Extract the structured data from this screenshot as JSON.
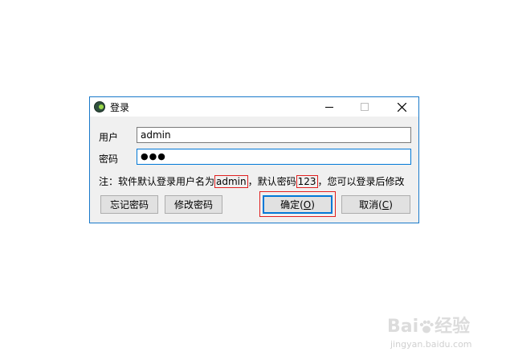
{
  "window": {
    "title": "登录",
    "username_label": "用户",
    "password_label": "密码",
    "username_value": "admin",
    "password_value": "●●●",
    "note_prefix": "注：软件默认登录用户名为",
    "note_user": "admin",
    "note_middle": "，默认密码",
    "note_pass": "123",
    "note_suffix": "，您可以登录后修改",
    "buttons": {
      "forgot": "忘记密码",
      "change": "修改密码",
      "ok_text": "确定(",
      "ok_key": "O",
      "ok_end": ")",
      "cancel_text": "取消(",
      "cancel_key": "C",
      "cancel_end": ")"
    }
  },
  "watermark": {
    "brand": "Bai",
    "brand_suffix": "经验",
    "url": "jingyan.baidu.com"
  },
  "colors": {
    "accent": "#0078d7",
    "highlight": "#e02020",
    "window_border": "#1979ca"
  },
  "icons": [
    "app-icon",
    "minimize-icon",
    "maximize-icon",
    "close-icon",
    "paw-icon"
  ]
}
